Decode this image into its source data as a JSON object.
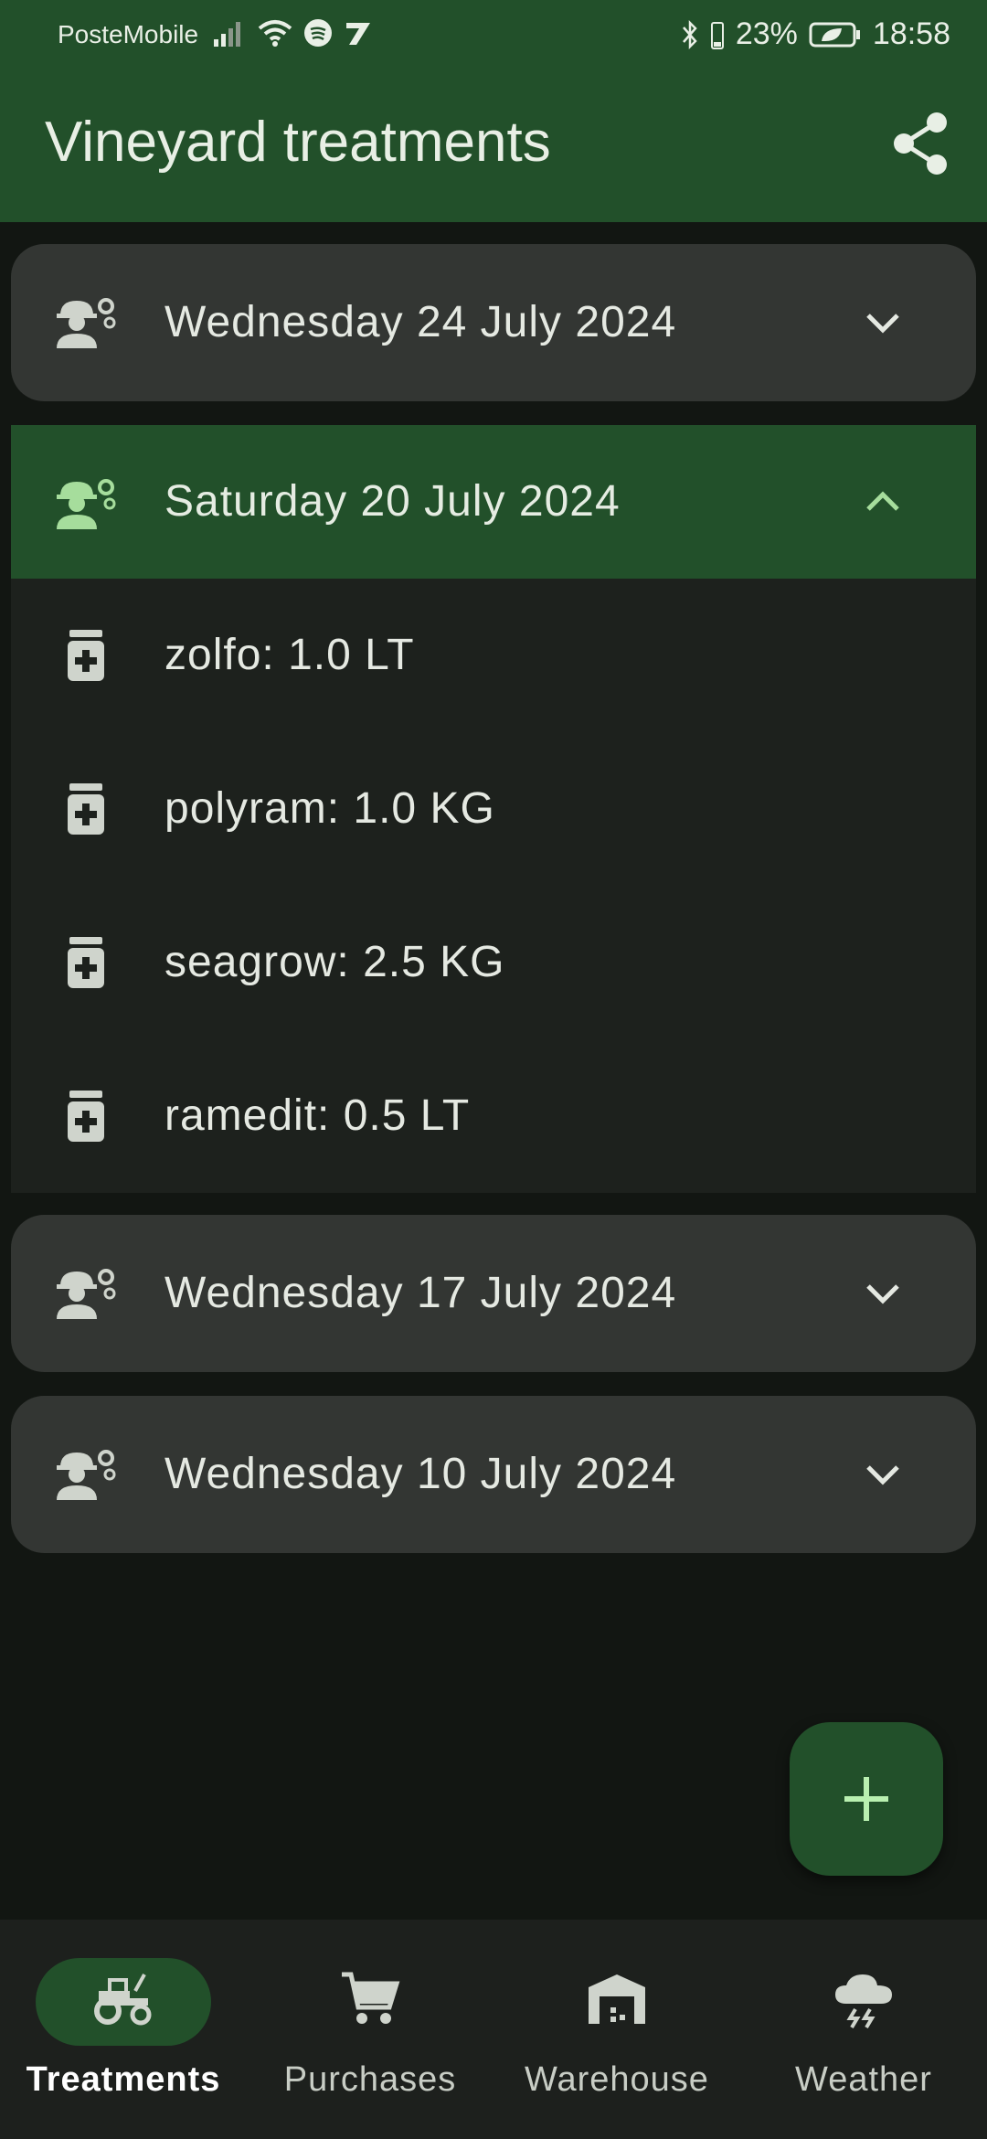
{
  "status_bar": {
    "carrier": "PosteMobile",
    "battery": "23%",
    "time": "18:58"
  },
  "app_bar": {
    "title": "Vineyard treatments",
    "share_icon": "share-icon"
  },
  "treatments": [
    {
      "date": "Wednesday 24 July 2024",
      "expanded": false
    },
    {
      "date": "Saturday 20 July 2024",
      "expanded": true,
      "products": [
        {
          "label": "zolfo: 1.0 LT"
        },
        {
          "label": "polyram: 1.0 KG"
        },
        {
          "label": "seagrow: 2.5 KG"
        },
        {
          "label": "ramedit: 0.5 LT"
        }
      ]
    },
    {
      "date": "Wednesday 17 July 2024",
      "expanded": false
    },
    {
      "date": "Wednesday 10 July 2024",
      "expanded": false
    }
  ],
  "fab": {
    "icon": "plus-icon"
  },
  "bottom_nav": [
    {
      "label": "Treatments",
      "icon": "tractor-icon",
      "active": true
    },
    {
      "label": "Purchases",
      "icon": "cart-icon",
      "active": false
    },
    {
      "label": "Warehouse",
      "icon": "warehouse-icon",
      "active": false
    },
    {
      "label": "Weather",
      "icon": "storm-icon",
      "active": false
    }
  ],
  "colors": {
    "primary": "#22502a",
    "background": "#121612",
    "card": "#333633",
    "fab_icon": "#b9f0b0"
  }
}
